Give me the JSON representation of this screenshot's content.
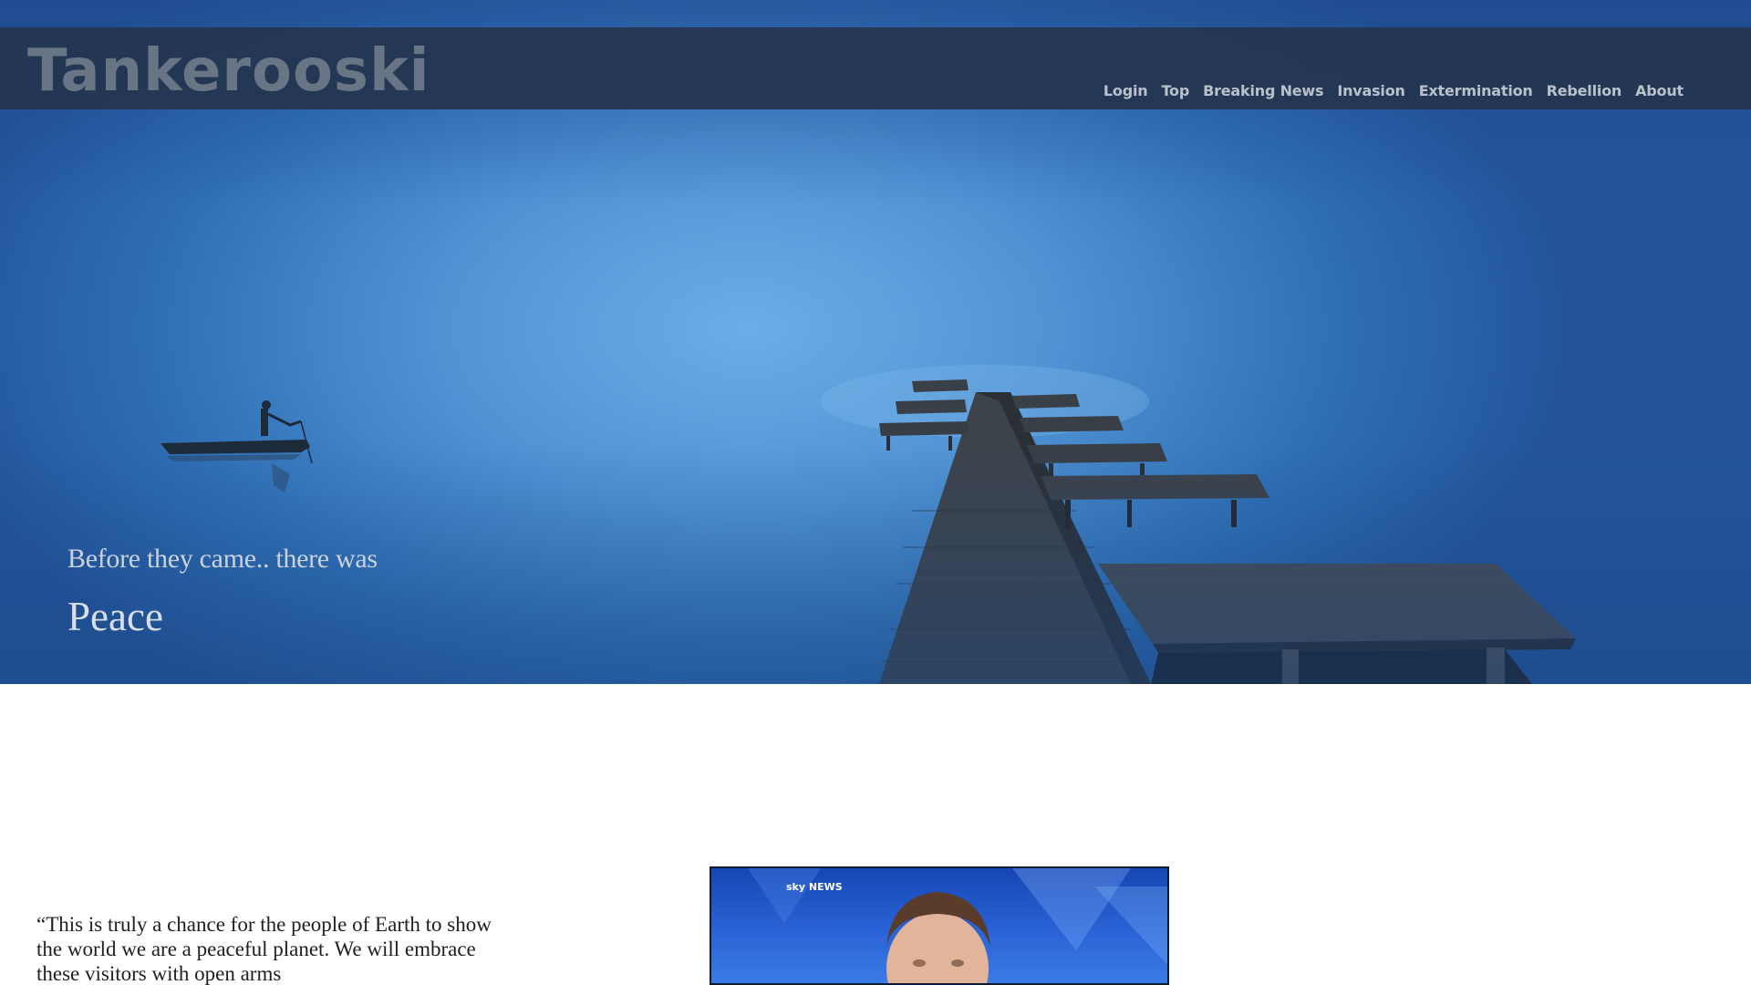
{
  "brand": {
    "title": "Tankerooski"
  },
  "nav": {
    "items": [
      {
        "label": "Login"
      },
      {
        "label": "Top"
      },
      {
        "label": "Breaking News"
      },
      {
        "label": "Invasion"
      },
      {
        "label": "Extermination"
      },
      {
        "label": "Rebellion"
      },
      {
        "label": "About"
      }
    ]
  },
  "hero": {
    "subtitle": "Before they came.. there was",
    "title": "Peace"
  },
  "article": {
    "quote": "“This is truly a chance for the people of Earth to show the world we are a peaceful planet. We will embrace these visitors with open arms"
  },
  "video": {
    "channel_logo": "sky NEWS"
  },
  "colors": {
    "navbar_bg": "#24344e",
    "brand_text": "#687585",
    "nav_text": "#b9c1cc",
    "hero_sky": "#5a9fe0"
  }
}
